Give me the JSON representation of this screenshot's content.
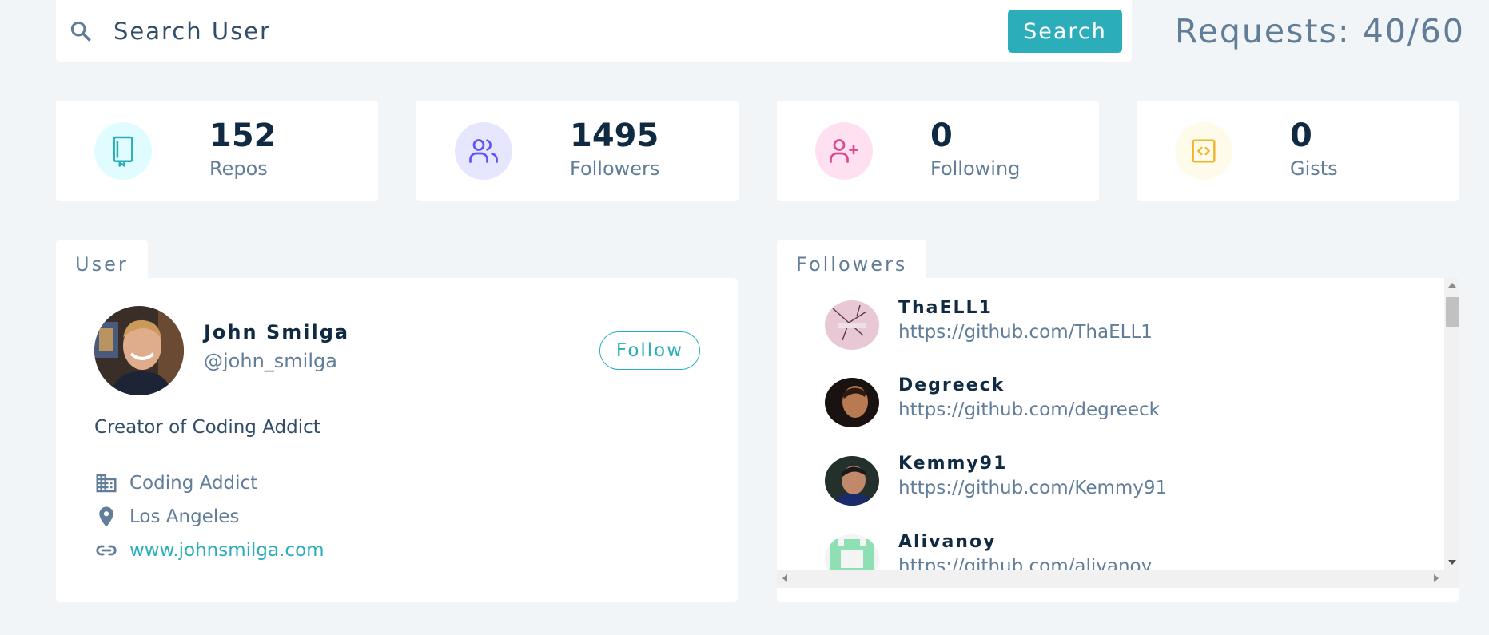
{
  "search": {
    "placeholder": "Search User",
    "button_label": "Search",
    "icon": "search-icon"
  },
  "requests": {
    "text": "Requests: 40/60"
  },
  "stats": [
    {
      "value": "152",
      "label": "Repos",
      "icon": "book-icon",
      "bg": "#e0fcff",
      "fg": "#2caeba"
    },
    {
      "value": "1495",
      "label": "Followers",
      "icon": "users-icon",
      "bg": "#e6e6ff",
      "fg": "#5d55fa"
    },
    {
      "value": "0",
      "label": "Following",
      "icon": "user-plus-icon",
      "bg": "#ffe0f0",
      "fg": "#da4a91"
    },
    {
      "value": "0",
      "label": "Gists",
      "icon": "code-icon",
      "bg": "#fffbea",
      "fg": "#f0b429"
    }
  ],
  "user_card": {
    "tab_label": "User",
    "name": "John Smilga",
    "handle": "@john_smilga",
    "follow_label": "Follow",
    "bio": "Creator of Coding Addict",
    "company": "Coding Addict",
    "location": "Los Angeles",
    "blog": "www.johnsmilga.com"
  },
  "followers_card": {
    "tab_label": "Followers",
    "list": [
      {
        "login": "ThaELL1",
        "url": "https://github.com/ThaELL1"
      },
      {
        "login": "Degreeck",
        "url": "https://github.com/degreeck"
      },
      {
        "login": "Kemmy91",
        "url": "https://github.com/Kemmy91"
      },
      {
        "login": "Alivanoy",
        "url": "https://github.com/alivanoy"
      }
    ]
  },
  "colors": {
    "accent": "#2caeba",
    "background": "#f1f5f8",
    "heading": "#102a42",
    "muted": "#617d98"
  }
}
